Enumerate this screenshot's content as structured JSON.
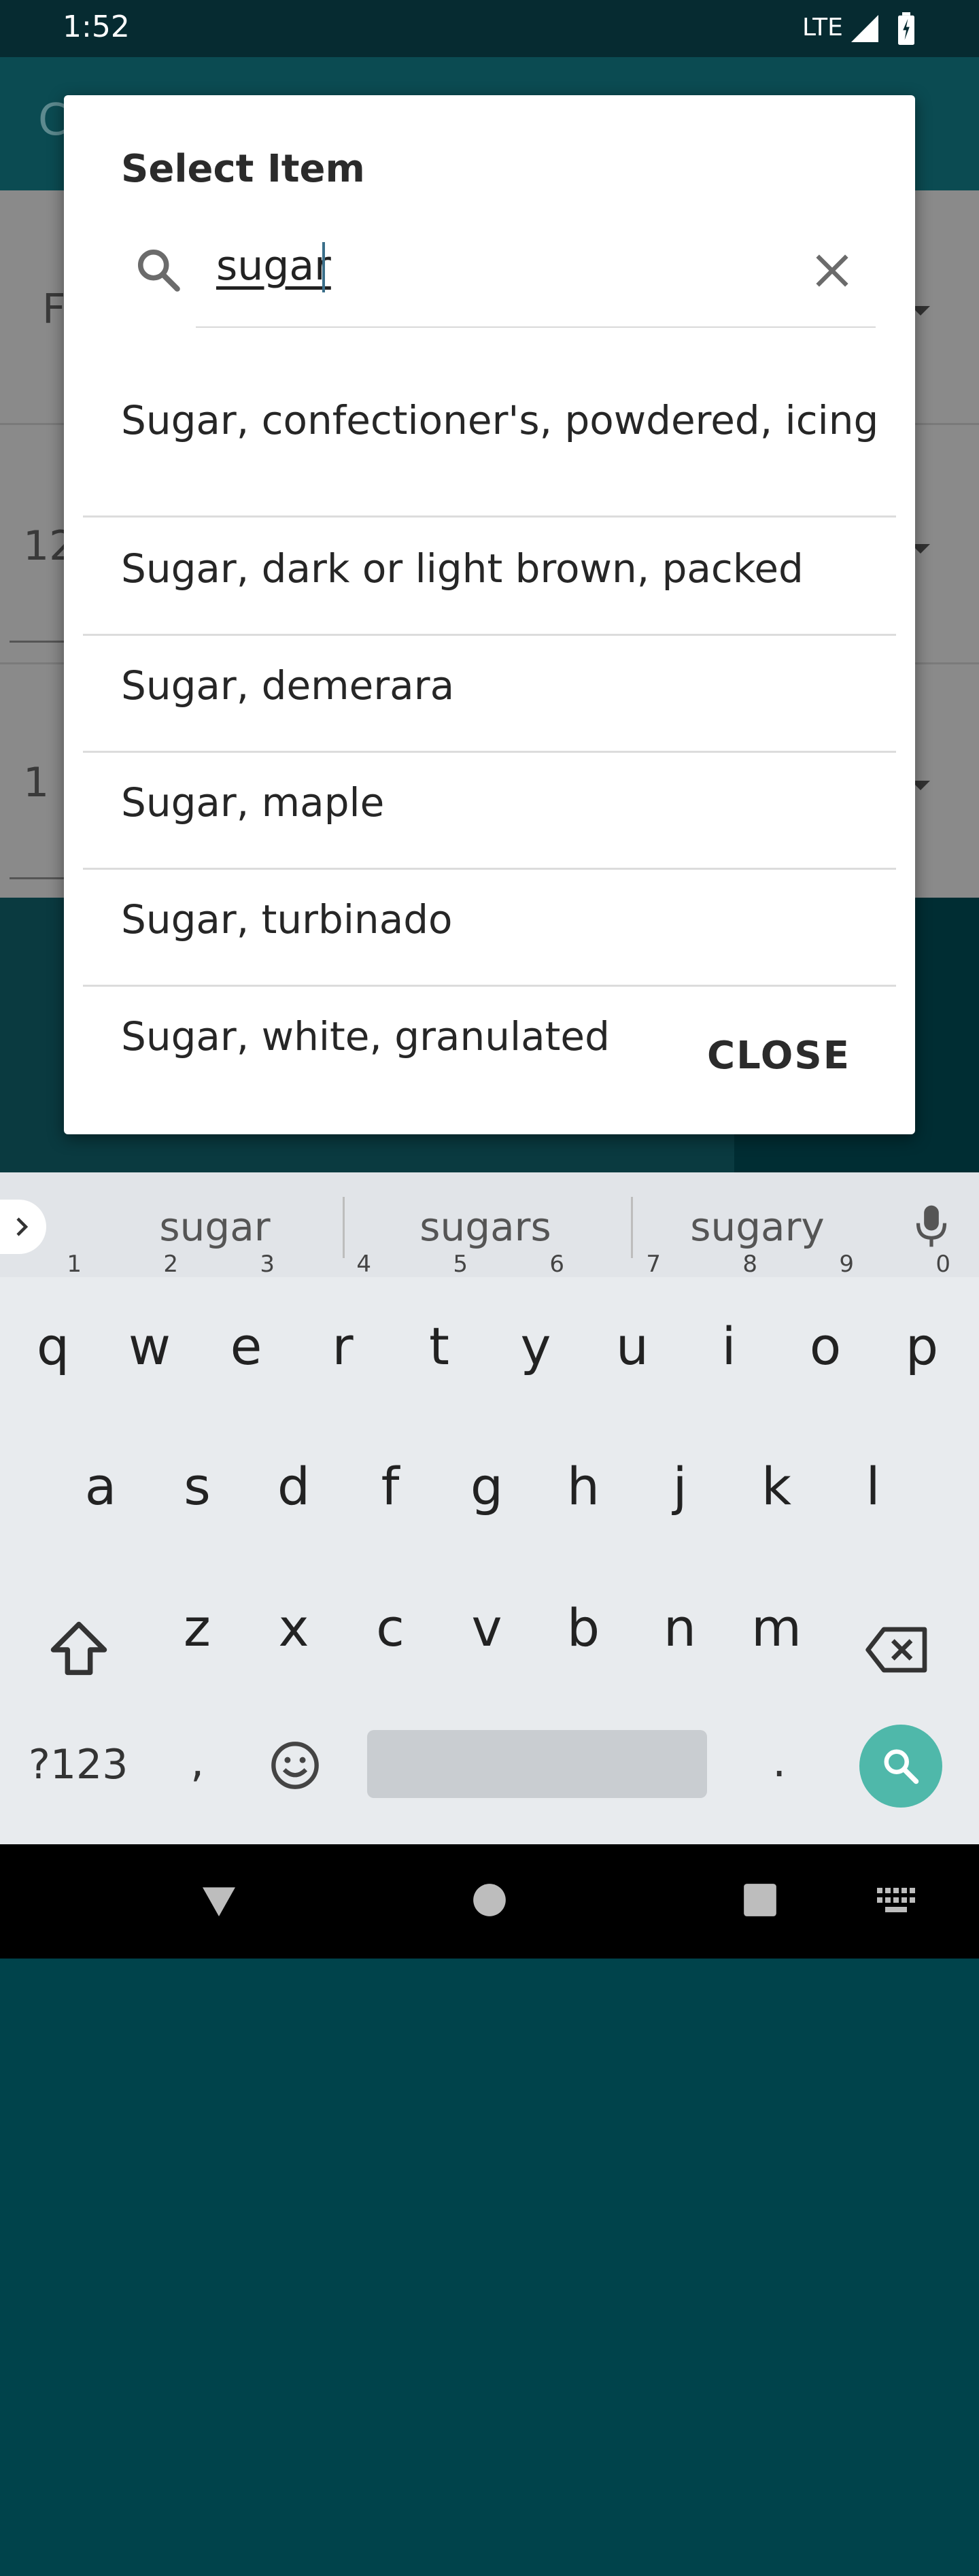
{
  "status_bar": {
    "time": "1:52",
    "network": "LTE"
  },
  "background": {
    "app_title_peek": "C",
    "field_1_peek": "F",
    "field_2_peek": "12",
    "field_3_peek": "1"
  },
  "dialog": {
    "title": "Select Item",
    "search": {
      "value": "sugar",
      "placeholder": ""
    },
    "results": [
      "Sugar, confectioner's, powdered, icing",
      "Sugar, dark or light brown, packed",
      "Sugar, demerara",
      "Sugar, maple",
      "Sugar, turbinado",
      "Sugar, white, granulated"
    ],
    "close_label": "CLOSE"
  },
  "keyboard": {
    "suggestions": [
      "sugar",
      "sugars",
      "sugary"
    ],
    "row1": [
      "q",
      "w",
      "e",
      "r",
      "t",
      "y",
      "u",
      "i",
      "o",
      "p"
    ],
    "row1_hints": [
      "1",
      "2",
      "3",
      "4",
      "5",
      "6",
      "7",
      "8",
      "9",
      "0"
    ],
    "row2": [
      "a",
      "s",
      "d",
      "f",
      "g",
      "h",
      "j",
      "k",
      "l"
    ],
    "row3": [
      "z",
      "x",
      "c",
      "v",
      "b",
      "n",
      "m"
    ],
    "symbols_label": "?123",
    "comma": ",",
    "period": "."
  },
  "icons": {
    "search": "search-icon",
    "clear": "close-icon",
    "mic": "mic-icon",
    "shift": "shift-icon",
    "backspace": "backspace-icon",
    "emoji": "emoji-icon",
    "action": "search-icon"
  },
  "colors": {
    "status_bar": "#062b31",
    "app_bar": "#0b4b52",
    "accent": "#4fb8aa",
    "dialog_bg": "#ffffff",
    "keyboard_bg": "#e8ebee"
  }
}
